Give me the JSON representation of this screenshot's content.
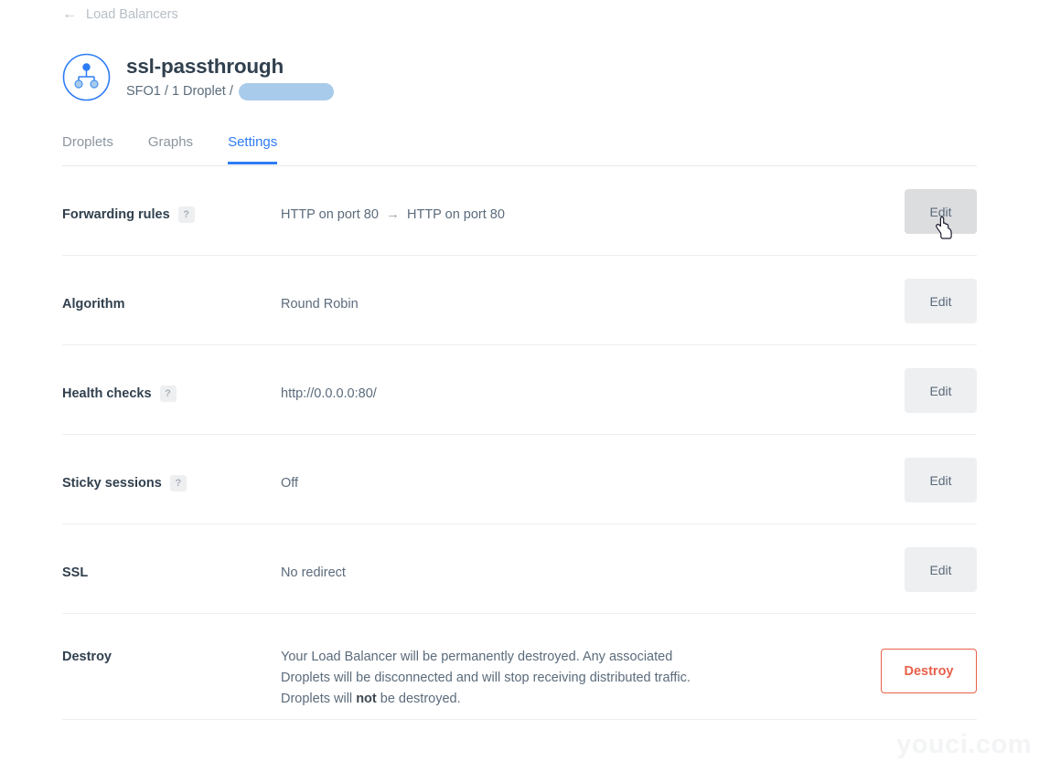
{
  "breadcrumb": {
    "back_label": "Load Balancers",
    "back_icon": "arrow-left-icon"
  },
  "header": {
    "icon": "load-balancer-icon",
    "title": "ssl-passthrough",
    "region": "SFO1",
    "droplet_count": "1 Droplet",
    "subtitle_prefix": "SFO1 / 1 Droplet /",
    "ip_redacted": true
  },
  "tabs": [
    {
      "label": "Droplets",
      "active": false
    },
    {
      "label": "Graphs",
      "active": false
    },
    {
      "label": "Settings",
      "active": true
    }
  ],
  "settings": {
    "rows": [
      {
        "label": "Forwarding rules",
        "help": "?",
        "has_help": true,
        "value_from": "HTTP on port 80",
        "value_arrow": "→",
        "value_to": "HTTP on port 80",
        "action_label": "Edit",
        "hovered": true
      },
      {
        "label": "Algorithm",
        "has_help": false,
        "value": "Round Robin",
        "action_label": "Edit",
        "hovered": false
      },
      {
        "label": "Health checks",
        "help": "?",
        "has_help": true,
        "value": "http://0.0.0.0:80/",
        "action_label": "Edit",
        "hovered": false
      },
      {
        "label": "Sticky sessions",
        "help": "?",
        "has_help": true,
        "value": "Off",
        "action_label": "Edit",
        "hovered": false
      },
      {
        "label": "SSL",
        "has_help": false,
        "value": "No redirect",
        "action_label": "Edit",
        "hovered": false
      }
    ],
    "destroy": {
      "label": "Destroy",
      "description_part1": "Your Load Balancer will be permanently destroyed. Any associated Droplets will be disconnected and will stop receiving distributed traffic. Droplets will ",
      "description_emphasis": "not",
      "description_part2": " be destroyed.",
      "action_label": "Destroy"
    }
  },
  "watermark": {
    "text": "youci.com"
  },
  "colors": {
    "accent_blue": "#2e7cf6",
    "danger_red": "#e9604a",
    "text_dark": "#31404e",
    "text_muted": "#5b6b7b",
    "badge_bg": "#eeeff1",
    "button_hover_bg": "#dcdddf",
    "redacted_pill": "#a8cbeb",
    "divider": "#edeef0"
  }
}
